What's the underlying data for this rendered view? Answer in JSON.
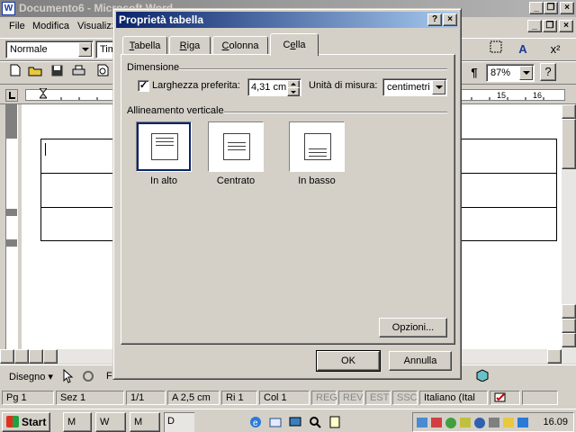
{
  "app": {
    "title": "Documento6 - Microsoft Word",
    "icon_letter": "W",
    "caption_buttons": [
      "_",
      "❐",
      "×"
    ]
  },
  "menu": {
    "items": [
      "File",
      "Modifica",
      "Visualizza"
    ],
    "right_buttons": [
      "_",
      "❐",
      "×"
    ]
  },
  "toolbar": {
    "style_value": "Normale",
    "font_value": "Tim",
    "zoom_value": "87%",
    "pilcrow": "¶",
    "help": "?"
  },
  "document": {
    "table_rows": 3
  },
  "dialog": {
    "title": "Proprietà tabella",
    "help_btn": "?",
    "close_btn": "×",
    "tabs": [
      {
        "label": "Tabella",
        "u": "T",
        "rest": "abella",
        "selected": false
      },
      {
        "label": "Riga",
        "u": "R",
        "rest": "iga",
        "selected": false
      },
      {
        "label": "Colonna",
        "u": "C",
        "rest": "olonna",
        "selected": false
      },
      {
        "label": "Cella",
        "u": "e",
        "pre": "C",
        "rest": "lla",
        "selected": true
      }
    ],
    "dimension": {
      "group_title": "Dimensione",
      "checkbox_checked": true,
      "checkbox_mark": "✓",
      "preferred_width_label": "Larghezza preferita:",
      "preferred_width_value": "4,31 cm",
      "unit_label": "Unità di misura:",
      "unit_value": "centimetri"
    },
    "vertical_alignment": {
      "group_title": "Allineamento verticale",
      "options": [
        {
          "label": "In alto",
          "selected": true
        },
        {
          "label": "Centrato",
          "selected": false
        },
        {
          "label": "In basso",
          "selected": false
        }
      ]
    },
    "options_button": "Opzioni...",
    "ok_button": "OK",
    "cancel_button": "Annulla"
  },
  "drawbar": {
    "draw_label": "Disegno",
    "f_label": "F"
  },
  "status": {
    "page": "Pg 1",
    "section": "Sez 1",
    "pages": "1/1",
    "at": "A 2,5 cm",
    "line": "Ri 1",
    "col": "Col 1",
    "modes": [
      "REG",
      "REV",
      "EST",
      "SSC"
    ],
    "language": "Italiano (Ital"
  },
  "taskbar": {
    "start_label": "Start",
    "buttons": [
      "M",
      "W",
      "M",
      "D"
    ],
    "clock": "16.09"
  }
}
